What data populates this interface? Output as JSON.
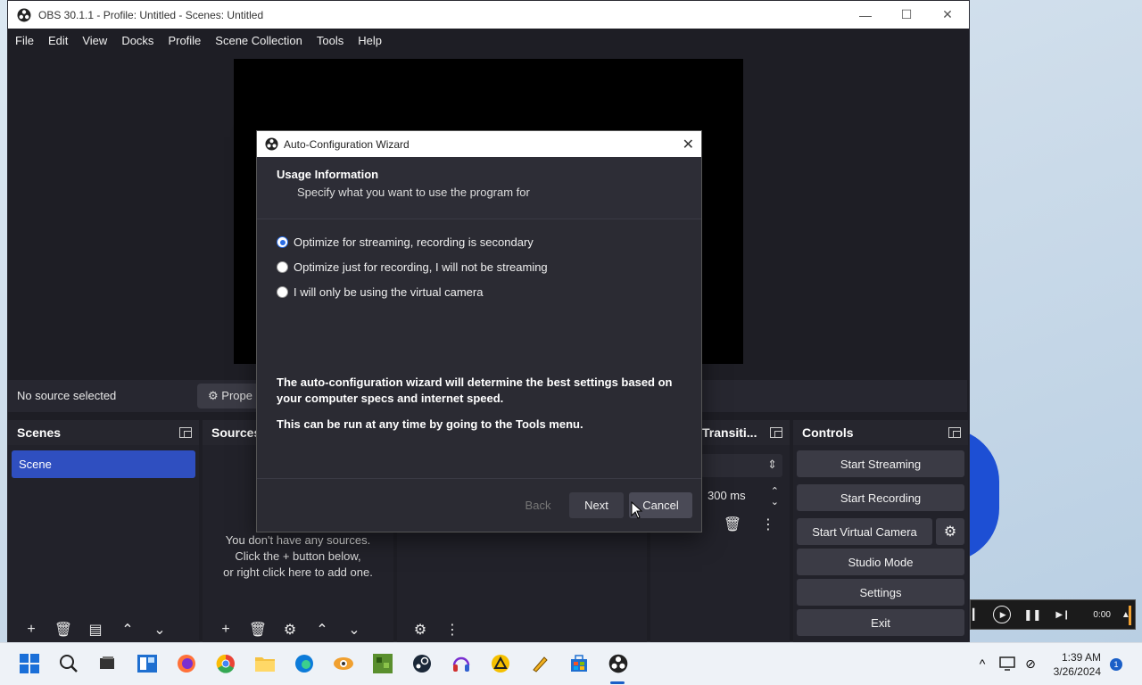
{
  "window": {
    "title": "OBS 30.1.1 - Profile: Untitled - Scenes: Untitled",
    "minimize": "—",
    "maximize": "☐",
    "close": "✕"
  },
  "menu": [
    "File",
    "Edit",
    "View",
    "Docks",
    "Profile",
    "Scene Collection",
    "Tools",
    "Help"
  ],
  "source_bar": {
    "no_source": "No source selected",
    "properties": "Prope"
  },
  "docks": {
    "scenes": {
      "title": "Scenes",
      "items": [
        "Scene"
      ]
    },
    "sources": {
      "title": "Sources",
      "empty_line1": "You don't have any sources.",
      "empty_line2": "Click the + button below,",
      "empty_line3": "or right click here to add one."
    },
    "transitions": {
      "title": "Transiti...",
      "duration": "300 ms"
    },
    "controls": {
      "title": "Controls",
      "start_streaming": "Start Streaming",
      "start_recording": "Start Recording",
      "start_virtual_camera": "Start Virtual Camera",
      "studio_mode": "Studio Mode",
      "settings": "Settings",
      "exit": "Exit"
    }
  },
  "dialog": {
    "title": "Auto-Configuration Wizard",
    "header": "Usage Information",
    "subheader": "Specify what you want to use the program for",
    "options": [
      {
        "label": "Optimize for streaming, recording is secondary",
        "selected": true
      },
      {
        "label": "Optimize just for recording, I will not be streaming",
        "selected": false
      },
      {
        "label": "I will only be using the virtual camera",
        "selected": false
      }
    ],
    "info1": "The auto-configuration wizard will determine the best settings based on your computer specs and internet speed.",
    "info2": "This can be run at any time by going to the Tools menu.",
    "back": "Back",
    "next": "Next",
    "cancel": "Cancel"
  },
  "media_widget": {
    "time": "0:00"
  },
  "taskbar": {
    "time": "1:39 AM",
    "date": "3/26/2024",
    "notifications": "1",
    "icons": [
      "start-icon",
      "search-icon",
      "task-view-icon",
      "widgets-icon",
      "firefox-icon",
      "chrome-icon",
      "file-explorer-icon",
      "edge-icon",
      "app-icon",
      "minecraft-icon",
      "steam-icon",
      "headphones-icon",
      "warning-app-icon",
      "pen-app-icon",
      "store-icon",
      "obs-icon"
    ]
  },
  "colors": {
    "accent": "#2f4fc0",
    "window_bg": "#1e1e25",
    "dock_bg": "#22222a",
    "button_bg": "#3b3b45"
  }
}
